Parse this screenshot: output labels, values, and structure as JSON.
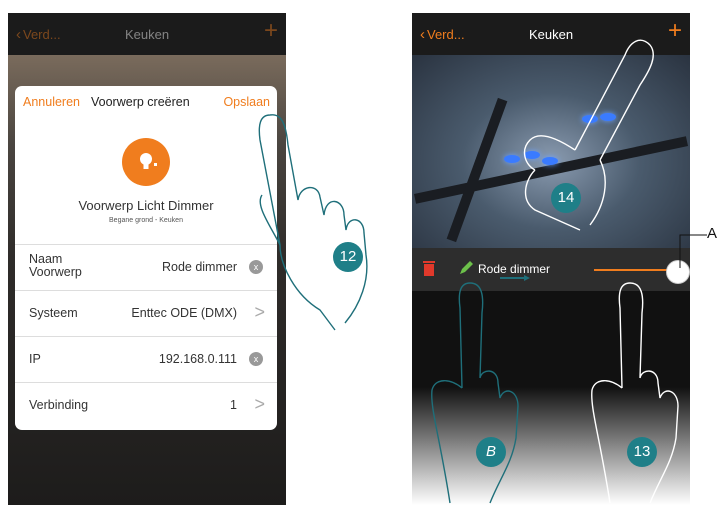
{
  "left_screen": {
    "back_label": "Verd...",
    "title": "Keuken",
    "plus": "+",
    "modal": {
      "cancel_label": "Annuleren",
      "title": "Voorwerp creëren",
      "save_label": "Opslaan",
      "object_name": "Voorwerp Licht Dimmer",
      "object_location": "Begane grond - Keuken",
      "rows": [
        {
          "label_line1": "Naam",
          "label_line2": "Voorwerp",
          "value": "Rode dimmer",
          "control": "clear"
        },
        {
          "label": "Systeem",
          "value": "Enttec ODE (DMX)",
          "control": "arrow"
        },
        {
          "label": "IP",
          "value": "192.168.0.111",
          "control": "clear"
        },
        {
          "label": "Verbinding",
          "value": "1",
          "control": "arrow"
        }
      ],
      "clear_symbol": "x",
      "arrow_symbol": ">"
    }
  },
  "right_screen": {
    "back_label": "Verd...",
    "title": "Keuken",
    "plus": "+",
    "device_name": "Rode dimmer",
    "slider_level": 1.0
  },
  "callouts": {
    "c12": "12",
    "c13": "13",
    "c14": "14",
    "cB": "B",
    "cA": "A"
  },
  "colors": {
    "accent": "#f07d1e",
    "badge": "#1f7f88",
    "topbar": "#1b1b1b"
  }
}
